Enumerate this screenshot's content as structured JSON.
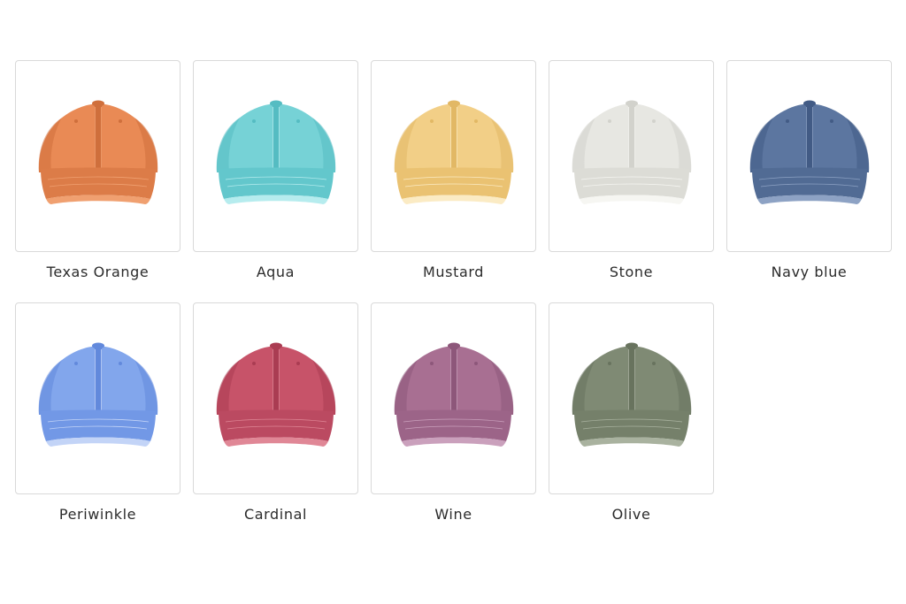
{
  "swatches": [
    {
      "label": "Texas Orange",
      "icon": "cap-image",
      "crown": "#e98a55",
      "shade": "#cf6f3c",
      "brim": "#dc7c48",
      "edge": "#f0a070"
    },
    {
      "label": "Aqua",
      "icon": "cap-image",
      "crown": "#76d2d6",
      "shade": "#55bcc2",
      "brim": "#63c7cc",
      "edge": "#b6ecee"
    },
    {
      "label": "Mustard",
      "icon": "cap-image",
      "crown": "#f2cf87",
      "shade": "#e2b865",
      "brim": "#eac272",
      "edge": "#fbebc4"
    },
    {
      "label": "Stone",
      "icon": "cap-image",
      "crown": "#e7e7e2",
      "shade": "#d2d2cc",
      "brim": "#dcdcd6",
      "edge": "#f6f6f2"
    },
    {
      "label": "Navy blue",
      "icon": "cap-image",
      "crown": "#5c76a0",
      "shade": "#425b85",
      "brim": "#516b94",
      "edge": "#8da2c4"
    },
    {
      "label": "Periwinkle",
      "icon": "cap-image",
      "crown": "#82a6ec",
      "shade": "#6289dc",
      "brim": "#7298e6",
      "edge": "#c3d4f7"
    },
    {
      "label": "Cardinal",
      "icon": "cap-image",
      "crown": "#c75369",
      "shade": "#aa3c52",
      "brim": "#bb4a61",
      "edge": "#e08796"
    },
    {
      "label": "Wine",
      "icon": "cap-image",
      "crown": "#a86f92",
      "shade": "#8d577a",
      "brim": "#9c6488",
      "edge": "#caa0bc"
    },
    {
      "label": "Olive",
      "icon": "cap-image",
      "crown": "#7f8a74",
      "shade": "#68735e",
      "brim": "#75806a",
      "edge": "#a9b29f"
    }
  ]
}
